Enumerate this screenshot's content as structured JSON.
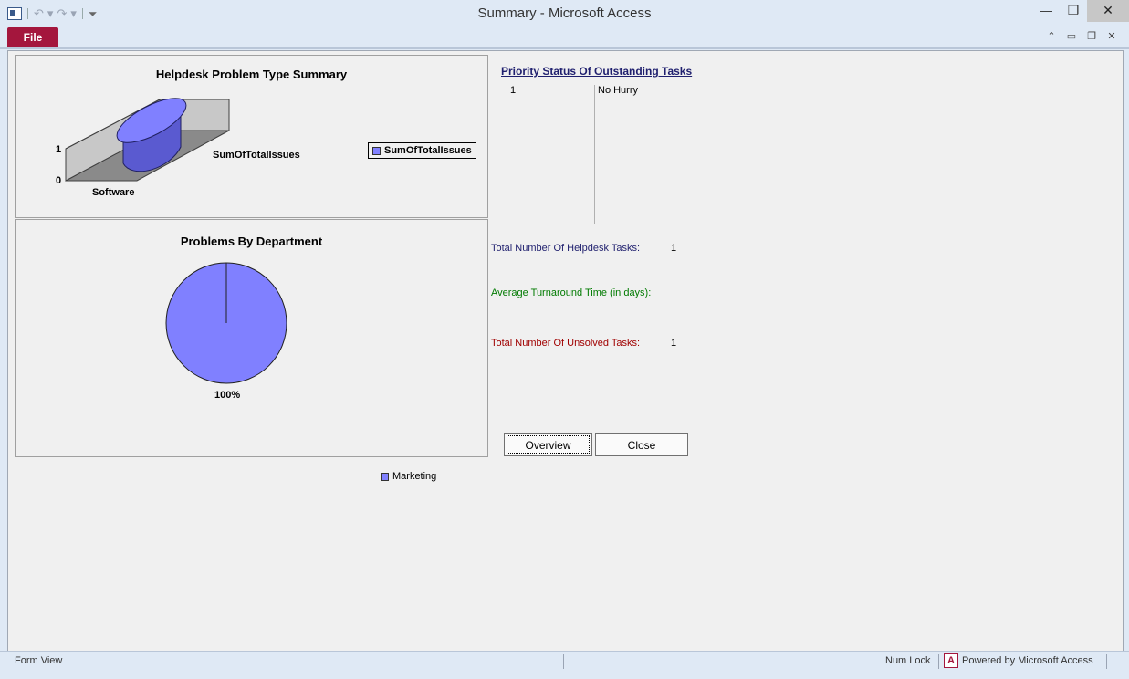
{
  "window": {
    "title": "Summary - Microsoft Access",
    "minimize": "—",
    "restore": "❐",
    "close": "✕"
  },
  "qat": {
    "undo": "↶",
    "redo": "↷",
    "dropdown": "▾",
    "customize": "⏷"
  },
  "ribbon": {
    "file_tab": "File",
    "icons": [
      "⌃",
      "▭",
      "❐",
      "✕"
    ]
  },
  "chart1": {
    "chart_data": {
      "type": "bar",
      "title": "Helpdesk Problem Type Summary",
      "categories": [
        "Software"
      ],
      "series": [
        {
          "name": "SumOfTotalIssues",
          "values": [
            1
          ]
        }
      ],
      "ylim": [
        0,
        1
      ],
      "yticks": [
        "0",
        "1"
      ],
      "depth_label": "SumOfTotalIssues",
      "legend": "right",
      "color": "#8080ff"
    }
  },
  "chart2": {
    "chart_data": {
      "type": "pie",
      "title": "Problems By Department",
      "labels": [
        "Marketing"
      ],
      "values": [
        100
      ],
      "data_label": "100%",
      "legend": "right",
      "color": "#8080ff"
    }
  },
  "priority": {
    "title": "Priority Status Of Outstanding Tasks",
    "rows": [
      {
        "count": "1",
        "status": "No Hurry"
      }
    ]
  },
  "stats": [
    {
      "label": "Total Number Of Helpdesk Tasks:",
      "value": "1",
      "color": "#1f1f6e"
    },
    {
      "label": "Average Turnaround Time (in days):",
      "value": "",
      "color": "#007a00"
    },
    {
      "label": "Total Number Of Unsolved Tasks:",
      "value": "1",
      "color": "#a00000"
    }
  ],
  "buttons": {
    "overview": "Overview",
    "close": "Close"
  },
  "statusbar": {
    "view": "Form View",
    "numlock": "Num Lock",
    "powered": "Powered by Microsoft Access",
    "access_icon": "A"
  }
}
